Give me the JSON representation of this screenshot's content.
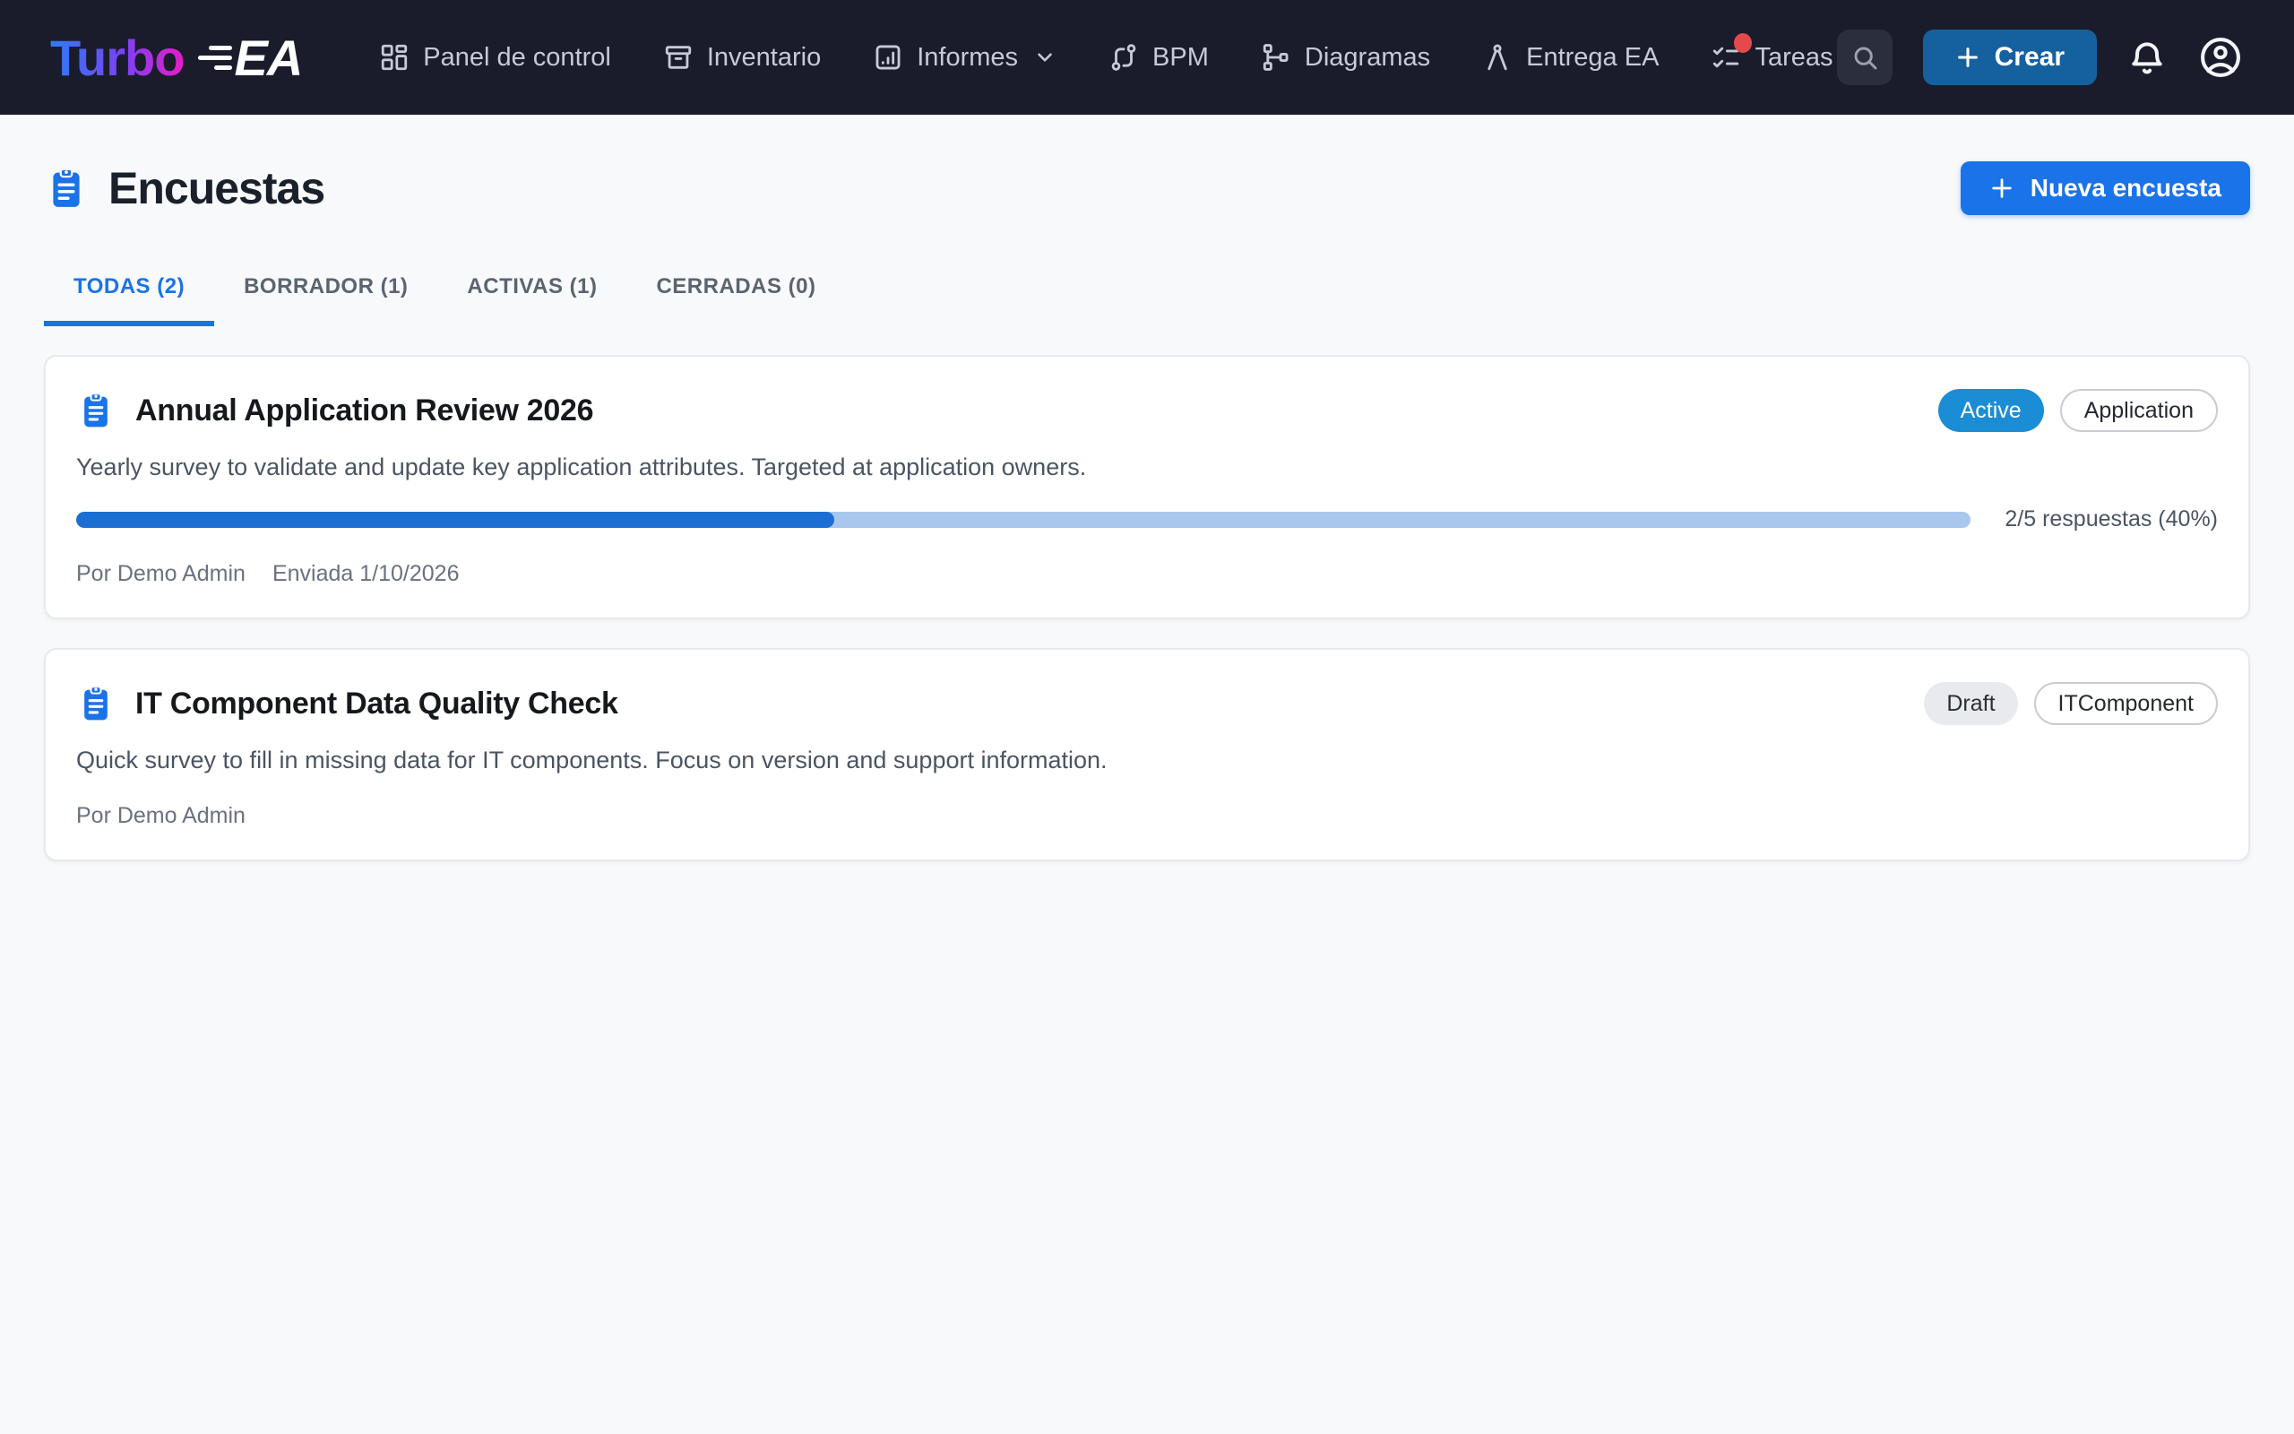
{
  "brand": {
    "name_gradient": "Turbo",
    "name_suffix": "EA"
  },
  "navbar": {
    "items": [
      {
        "label": "Panel de control",
        "icon": "dashboard-icon"
      },
      {
        "label": "Inventario",
        "icon": "archive-icon"
      },
      {
        "label": "Informes",
        "icon": "chart-icon",
        "has_dropdown": true
      },
      {
        "label": "BPM",
        "icon": "route-icon"
      },
      {
        "label": "Diagramas",
        "icon": "diagram-tree-icon"
      },
      {
        "label": "Entrega EA",
        "icon": "compass-icon"
      },
      {
        "label": "Tareas",
        "icon": "checklist-icon",
        "notification_dot": true
      }
    ],
    "create_label": "Crear"
  },
  "page": {
    "title": "Encuestas",
    "new_survey_label": "Nueva encuesta",
    "tabs": [
      {
        "label": "TODAS (2)",
        "active": true
      },
      {
        "label": "BORRADOR (1)",
        "active": false
      },
      {
        "label": "ACTIVAS (1)",
        "active": false
      },
      {
        "label": "CERRADAS (0)",
        "active": false
      }
    ],
    "surveys": [
      {
        "title": "Annual Application Review 2026",
        "description": "Yearly survey to validate and update key application attributes. Targeted at application owners.",
        "status": "Active",
        "type": "Application",
        "progress_percent": 40,
        "progress_label": "2/5 respuestas (40%)",
        "author": "Por Demo Admin",
        "sent": "Enviada 1/10/2026"
      },
      {
        "title": "IT Component Data Quality Check",
        "description": "Quick survey to fill in missing data for IT components. Focus on version and support information.",
        "status": "Draft",
        "type": "ITComponent",
        "author": "Por Demo Admin"
      }
    ]
  },
  "colors": {
    "navbar_bg": "#1a1c2c",
    "accent_blue": "#1a73e8",
    "create_button_blue": "#15619f",
    "active_badge_blue": "#1b8dd4",
    "progress_fill": "#1c6fd2",
    "progress_track": "#a9c7ec",
    "notification_red": "#e5484d",
    "page_bg": "#f8f9fb"
  }
}
